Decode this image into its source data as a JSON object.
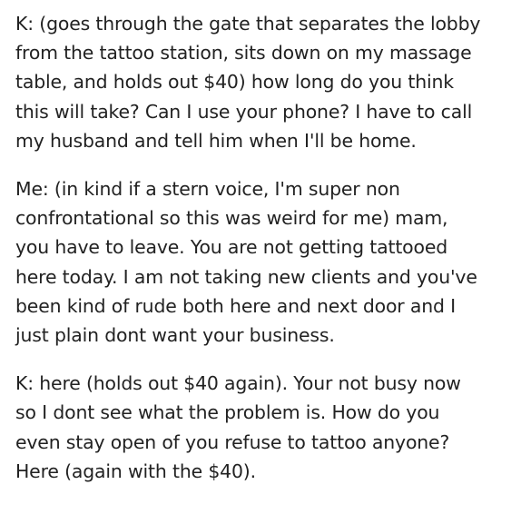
{
  "post": {
    "paragraphs": [
      {
        "lines": [
          "K: (goes through the gate that separates the lobby",
          "from the tattoo station, sits down on my massage",
          "table, and holds out $40) how long do you think",
          "this will take? Can I use your phone? I have to call",
          "my husband and tell him when I'll be home."
        ]
      },
      {
        "lines": [
          "Me: (in kind if a stern voice, I'm super non",
          "confrontational so this was weird for me) mam,",
          "you have to leave. You are not getting tattooed",
          "here today. I am not taking new clients and you've",
          "been kind of rude both here and next door and I",
          "just plain dont want your business."
        ]
      },
      {
        "lines": [
          "K: here (holds out $40 again). Your not busy now",
          "so I dont see what the problem is. How do you",
          "even stay open of you refuse to tattoo anyone?",
          "Here (again with the $40)."
        ]
      }
    ]
  }
}
